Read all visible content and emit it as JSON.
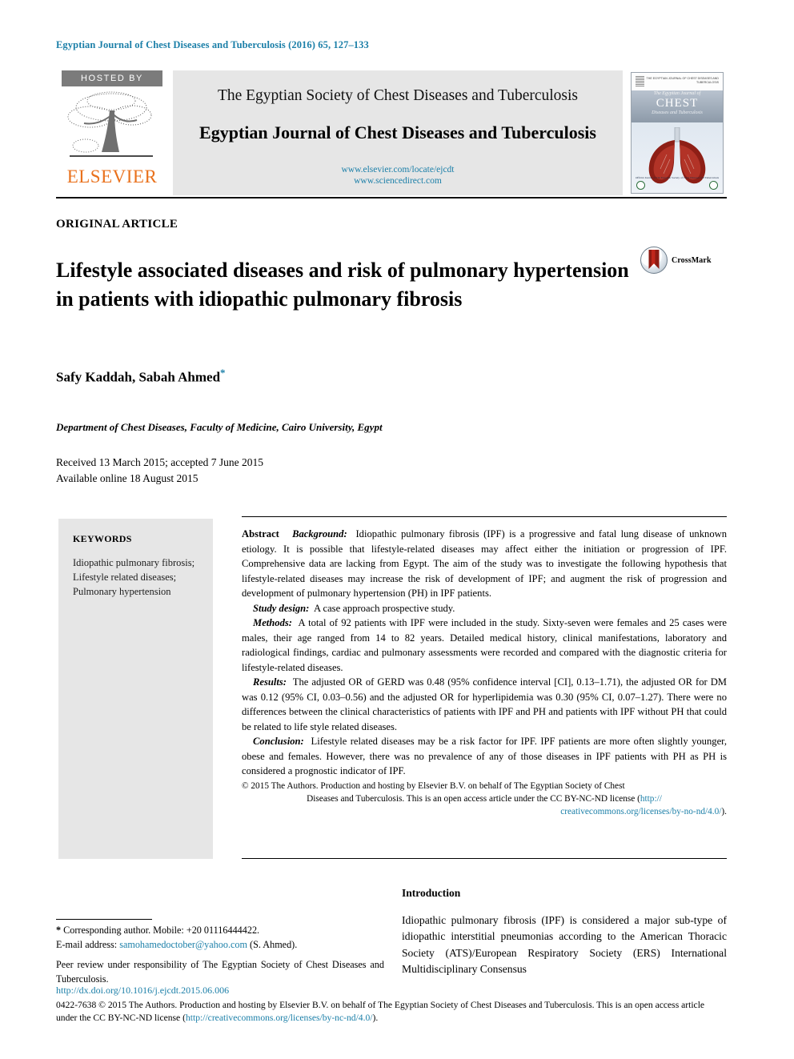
{
  "running_head": "Egyptian Journal of Chest Diseases and Tuberculosis (2016) 65, 127–133",
  "banner": {
    "hosted_by": "HOSTED BY",
    "publisher": "ELSEVIER",
    "society_line": "The Egyptian Society of Chest Diseases and Tuberculosis",
    "journal_line": "Egyptian Journal of Chest Diseases and Tuberculosis",
    "url_locate": "www.elsevier.com/locate/ejcdt",
    "url_sciencedirect": "www.sciencedirect.com",
    "cover": {
      "brand": "THE EGYPTIAN JOURNAL OF\nCHEST DISEASES AND TUBERCULOSIS",
      "line1": "The Egyptian Journal of",
      "line2": "CHEST",
      "line3": "Diseases and Tuberculosis",
      "footer": "Official Journal of The Egyptian Society of Chest Diseases and Tuberculosis"
    }
  },
  "article": {
    "kind": "ORIGINAL ARTICLE",
    "title": "Lifestyle associated diseases and risk of pulmonary hypertension in patients with idiopathic pulmonary fibrosis",
    "crossmark_label": "CrossMark",
    "authors": "Safy Kaddah, Sabah Ahmed",
    "corresponding_marker": "*",
    "affiliation": "Department of Chest Diseases, Faculty of Medicine, Cairo University, Egypt",
    "received": "Received 13 March 2015; accepted 7 June 2015",
    "available": "Available online 18 August 2015"
  },
  "keywords": {
    "heading": "KEYWORDS",
    "items": [
      "Idiopathic pulmonary fibrosis;",
      "Lifestyle related diseases;",
      "Pulmonary hypertension"
    ]
  },
  "abstract": {
    "heading": "Abstract",
    "background_label": "Background:",
    "background_text": "Idiopathic pulmonary fibrosis (IPF) is a progressive and fatal lung disease of unknown etiology. It is possible that lifestyle-related diseases may affect either the initiation or progression of IPF. Comprehensive data are lacking from Egypt. The aim of the study was to investigate the following hypothesis that lifestyle-related diseases may increase the risk of development of IPF; and augment the risk of progression and development of pulmonary hypertension (PH) in IPF patients.",
    "study_design_label": "Study design:",
    "study_design_text": "A case approach prospective study.",
    "methods_label": "Methods:",
    "methods_text": "A total of 92 patients with IPF were included in the study. Sixty-seven were females and 25 cases were males, their age ranged from 14 to 82 years. Detailed medical history, clinical manifestations, laboratory and radiological findings, cardiac and pulmonary assessments were recorded and compared with the diagnostic criteria for lifestyle-related diseases.",
    "results_label": "Results:",
    "results_text": "The adjusted OR of GERD was 0.48 (95% confidence interval [CI], 0.13–1.71), the adjusted OR for DM was 0.12 (95% CI, 0.03–0.56) and the adjusted OR for hyperlipidemia was 0.30 (95% CI, 0.07–1.27). There were no differences between the clinical characteristics of patients with IPF and PH and patients with IPF without PH that could be related to life style related diseases.",
    "conclusion_label": "Conclusion:",
    "conclusion_text": "Lifestyle related diseases may be a risk factor for IPF. IPF patients are more often slightly younger, obese and females. However, there was no prevalence of any of those diseases in IPF patients with PH as PH is considered a prognostic indicator of IPF.",
    "copyright_line1": "© 2015 The Authors. Production and hosting by Elsevier B.V. on behalf of The Egyptian Society of Chest",
    "copyright_line2": "Diseases and Tuberculosis. This is an open access article under the CC BY-NC-ND license (",
    "copyright_link_part1": "http://",
    "copyright_link_part2": "creativecommons.org/licenses/by-no-nd/4.0/",
    "copyright_tail": ")."
  },
  "introduction": {
    "heading": "Introduction",
    "text": "Idiopathic pulmonary fibrosis (IPF) is considered a major sub-type of idiopathic interstitial pneumonias according to the American Thoracic Society (ATS)/European Respiratory Society (ERS) International Multidisciplinary Consensus"
  },
  "footnotes": {
    "corresponding": "Corresponding author. Mobile: +20 01116444422.",
    "email_label": "E-mail address:",
    "email": "samohamedoctober@yahoo.com",
    "email_suffix": "(S. Ahmed).",
    "peer_review": "Peer review under responsibility of The Egyptian Society of Chest Diseases and Tuberculosis.",
    "doi": "http://dx.doi.org/10.1016/j.ejcdt.2015.06.006",
    "legal_pre": "0422-7638 © 2015 The Authors. Production and hosting by Elsevier B.V. on behalf of The Egyptian Society of Chest Diseases and Tuberculosis. This is an open access article under the CC BY-NC-ND license (",
    "legal_link": "http://creativecommons.org/licenses/by-nc-nd/4.0/",
    "legal_post": ")."
  },
  "colors": {
    "link": "#1b7fa8",
    "elsevier_orange": "#E9711C",
    "keyword_panel": "#e6e6e6",
    "banner_panel": "#e6e6e6",
    "hosted_tag": "#7b7b7b",
    "crossmark_red": "#c0261b"
  }
}
